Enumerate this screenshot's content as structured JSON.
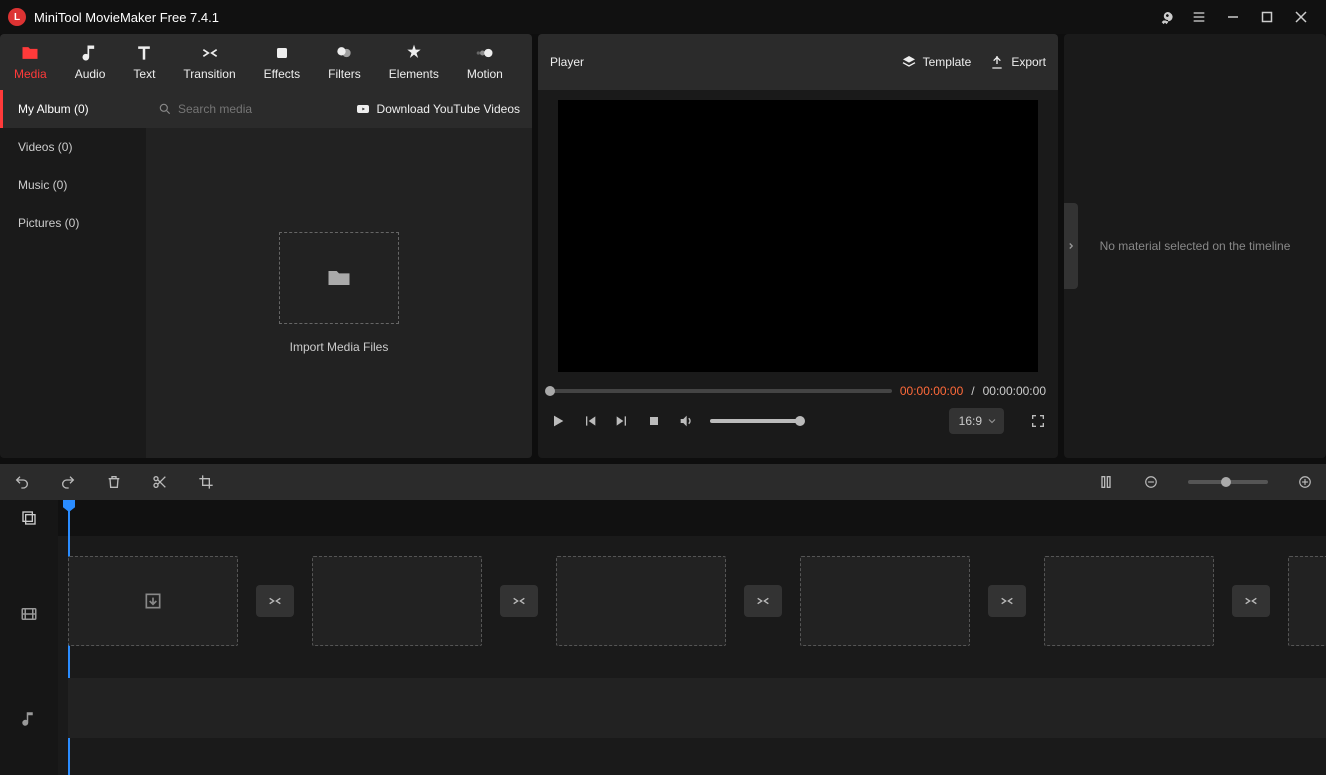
{
  "title": "MiniTool MovieMaker Free 7.4.1",
  "toolTabs": [
    {
      "label": "Media"
    },
    {
      "label": "Audio"
    },
    {
      "label": "Text"
    },
    {
      "label": "Transition"
    },
    {
      "label": "Effects"
    },
    {
      "label": "Filters"
    },
    {
      "label": "Elements"
    },
    {
      "label": "Motion"
    }
  ],
  "mediaSidebar": [
    {
      "label": "My Album (0)"
    },
    {
      "label": "Videos (0)"
    },
    {
      "label": "Music (0)"
    },
    {
      "label": "Pictures (0)"
    }
  ],
  "searchPlaceholder": "Search media",
  "downloadLabel": "Download YouTube Videos",
  "importLabel": "Import Media Files",
  "player": {
    "title": "Player",
    "templateLabel": "Template",
    "exportLabel": "Export",
    "currentTime": "00:00:00:00",
    "separator": "/",
    "totalTime": "00:00:00:00",
    "ratio": "16:9"
  },
  "inspector": {
    "emptyText": "No material selected on the timeline"
  }
}
